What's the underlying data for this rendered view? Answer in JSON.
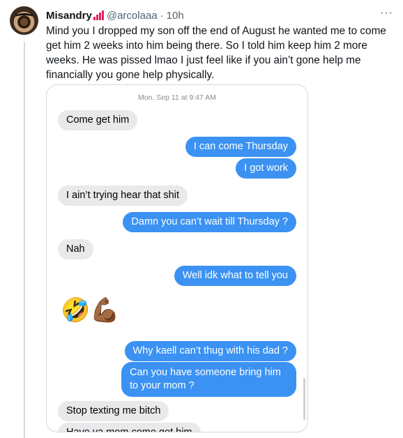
{
  "tweet": {
    "display_name": "Misandry",
    "handle": "@arcolaaa",
    "separator": "·",
    "time": "10h",
    "more": "···",
    "text": "Mind you I dropped my son off the end of August he wanted me to come get him 2 weeks into him being there. So I told him keep him 2 more weeks. He was pissed lmao I just feel like if you ain’t gone help me financially you gone help physically."
  },
  "screenshot": {
    "timestamp": "Mon, Sep 11 at 9:47 AM",
    "messages": [
      {
        "from": "them",
        "text": "Come get him"
      },
      {
        "from": "me",
        "text": "I can come Thursday"
      },
      {
        "from": "me",
        "text": "I got work"
      },
      {
        "from": "them",
        "text": "I ain’t trying hear that shit"
      },
      {
        "from": "me",
        "text": "Damn you can’t wait till Thursday ?"
      },
      {
        "from": "them",
        "text": "Nah"
      },
      {
        "from": "me",
        "text": "Well idk what to tell you"
      },
      {
        "from": "them",
        "emoji": "🤣💪🏾"
      },
      {
        "from": "me",
        "text": "Why kaell can’t thug with his dad ?"
      },
      {
        "from": "me",
        "text": "Can you have someone bring him to your mom ?"
      },
      {
        "from": "them",
        "text": "Stop texting me bitch"
      },
      {
        "from": "them",
        "text": "Have ya mom come get him"
      }
    ]
  },
  "colors": {
    "sent": "#3b92f2",
    "received": "#e9e9eb",
    "badge": "#e0245e"
  }
}
